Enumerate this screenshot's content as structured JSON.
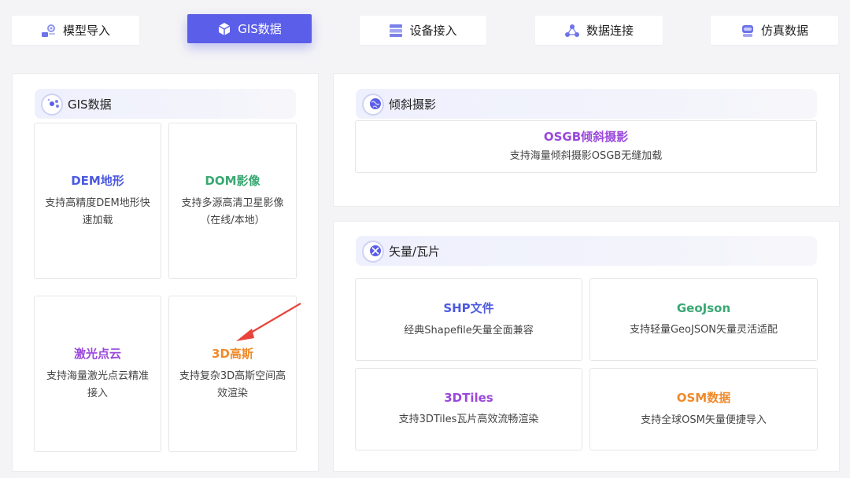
{
  "tabs": [
    {
      "label": "模型导入",
      "icon": "model-import-icon"
    },
    {
      "label": "GIS数据",
      "icon": "cube-icon",
      "active": true
    },
    {
      "label": "设备接入",
      "icon": "server-icon"
    },
    {
      "label": "数据连接",
      "icon": "network-icon"
    },
    {
      "label": "仿真数据",
      "icon": "robot-icon"
    }
  ],
  "gis": {
    "title": "GIS数据",
    "cards": [
      {
        "title": "DEM地形",
        "desc": "支持高精度DEM地形快速加载"
      },
      {
        "title": "DOM影像",
        "desc": "支持多源高清卫星影像（在线/本地）"
      },
      {
        "title": "激光点云",
        "desc": "支持海量激光点云精准接入"
      },
      {
        "title": "3D高斯",
        "desc": "支持复杂3D高斯空间高效渲染"
      }
    ]
  },
  "oblique": {
    "title": "倾斜摄影",
    "cards": [
      {
        "title": "OSGB倾斜摄影",
        "desc": "支持海量倾斜摄影OSGB无缝加载"
      }
    ]
  },
  "vector": {
    "title": "矢量/瓦片",
    "cards": [
      {
        "title": "SHP文件",
        "desc": "经典Shapefile矢量全面兼容"
      },
      {
        "title": "GeoJson",
        "desc": "支持轻量GeoJSON矢量灵活适配"
      },
      {
        "title": "3DTiles",
        "desc": "支持3DTiles瓦片高效流畅渲染"
      },
      {
        "title": "OSM数据",
        "desc": "支持全球OSM矢量便捷导入"
      }
    ]
  },
  "colors": {
    "accent": "#5b5ee8",
    "blue": "#4d5ae0",
    "green": "#3aa873",
    "purple": "#9a48dd",
    "orange": "#ef8a2b",
    "annotation_arrow": "#e8443a"
  }
}
